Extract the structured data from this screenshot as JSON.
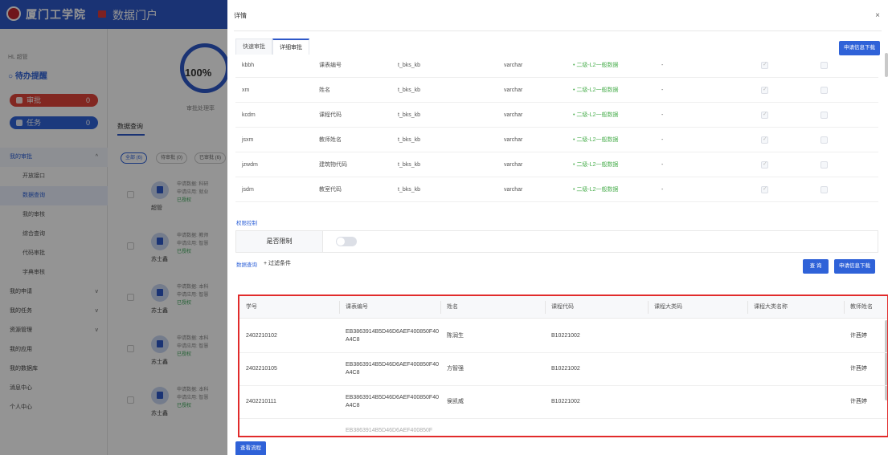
{
  "header": {
    "logo_text": "厦门工学院",
    "portal_title": "数据门户"
  },
  "sidebar": {
    "user": "HL 超管",
    "pending_title": "待办提醒",
    "approve": {
      "label": "审批",
      "count": "0"
    },
    "tasks": {
      "label": "任务",
      "count": "0"
    },
    "menu": [
      {
        "label": "我的审批",
        "type": "top",
        "chev": "^"
      },
      {
        "label": "开放接口",
        "type": "sub"
      },
      {
        "label": "数据查询",
        "type": "sub"
      },
      {
        "label": "我的审核",
        "type": "sub"
      },
      {
        "label": "综合查询",
        "type": "sub"
      },
      {
        "label": "代码审批",
        "type": "sub"
      },
      {
        "label": "字典审核",
        "type": "sub"
      },
      {
        "label": "我的申请",
        "type": "top",
        "chev": "v"
      },
      {
        "label": "我的任务",
        "type": "top",
        "chev": "v"
      },
      {
        "label": "资源管理",
        "type": "top",
        "chev": "v"
      },
      {
        "label": "我的应用",
        "type": "top",
        "chev": ""
      },
      {
        "label": "我的数据库",
        "type": "top",
        "chev": ""
      },
      {
        "label": "消息中心",
        "type": "top",
        "chev": ""
      },
      {
        "label": "个人中心",
        "type": "top",
        "chev": ""
      }
    ]
  },
  "background": {
    "gauge_value": "100%",
    "gauge_label": "审批处理率",
    "tab": "数据查询",
    "filters": [
      "全部 (6)",
      "待审批 (0)",
      "已审批 (6)"
    ],
    "rows": [
      {
        "name": "超管",
        "line1": "申请数据: 科研",
        "line2": "申请应用: 就业",
        "status": "已授权"
      },
      {
        "name": "苏士鑫",
        "line1": "申请数据: 教师",
        "line2": "申请应用: 智慧",
        "status": "已授权"
      },
      {
        "name": "苏士鑫",
        "line1": "申请数据: 本科",
        "line2": "申请应用: 智慧",
        "status": "已授权"
      },
      {
        "name": "苏士鑫",
        "line1": "申请数据: 本科",
        "line2": "申请应用: 智慧",
        "status": "已授权"
      },
      {
        "name": "苏士鑫",
        "line1": "申请数据: 本科",
        "line2": "申请应用: 智慧",
        "status": "已授权"
      }
    ]
  },
  "drawer": {
    "title": "详情",
    "close": "×",
    "tabs": [
      "快速审批",
      "详细审批"
    ],
    "download_btn": "申请信息下载",
    "fields": [
      {
        "code": "kbbh",
        "name": "课表编号",
        "table": "t_bks_kb",
        "type": "varchar",
        "level": "• 二级-L2一般数据",
        "dash": "-"
      },
      {
        "code": "xm",
        "name": "姓名",
        "table": "t_bks_kb",
        "type": "varchar",
        "level": "• 二级-L2一般数据",
        "dash": "-"
      },
      {
        "code": "kcdm",
        "name": "课程代码",
        "table": "t_bks_kb",
        "type": "varchar",
        "level": "• 二级-L2一般数据",
        "dash": "-"
      },
      {
        "code": "jsxm",
        "name": "教师姓名",
        "table": "t_bks_kb",
        "type": "varchar",
        "level": "• 二级-L2一般数据",
        "dash": "-"
      },
      {
        "code": "jzwdm",
        "name": "建筑物代码",
        "table": "t_bks_kb",
        "type": "varchar",
        "level": "• 二级-L2一般数据",
        "dash": "-"
      },
      {
        "code": "jsdm",
        "name": "教室代码",
        "table": "t_bks_kb",
        "type": "varchar",
        "level": "• 二级-L2一般数据",
        "dash": "-"
      }
    ],
    "permission": {
      "section_title": "权限控制",
      "label": "是否限制"
    },
    "query": {
      "section_title": "数据查询",
      "add_filter": "+ 过滤条件",
      "query_btn": "查 询",
      "download_btn": "申请信息下载"
    },
    "result": {
      "headers": [
        "学号",
        "课表编号",
        "姓名",
        "课程代码",
        "课程大类码",
        "课程大类名称",
        "教师姓名"
      ],
      "rows": [
        [
          "2402210102",
          "EB3863914B5D46D6AEF400850F40A4C8",
          "陈润生",
          "B10221002",
          "",
          "",
          "许茜婷"
        ],
        [
          "2402210105",
          "EB3863914B5D46D6AEF400850F40A4C8",
          "方智强",
          "B10221002",
          "",
          "",
          "许茜婷"
        ],
        [
          "2402210111",
          "EB3863914B5D46D6AEF400850F40A4C8",
          "侯凯威",
          "B10221002",
          "",
          "",
          "许茜婷"
        ]
      ]
    },
    "trace_btn": "查看流程"
  },
  "colors": {
    "primary": "#2f62d8",
    "header": "#2e58c8",
    "danger": "#e0443a",
    "highlight_border": "#e12b2b",
    "level_green": "#4caf50"
  }
}
